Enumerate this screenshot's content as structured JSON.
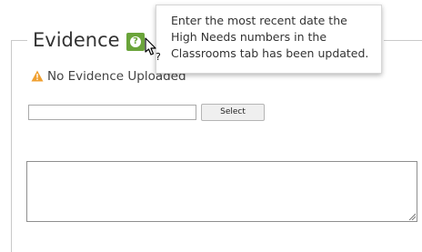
{
  "section": {
    "legend": "Evidence",
    "status_text": "No Evidence Uploaded",
    "help_icon": "question-icon",
    "warning_icon": "warning-icon"
  },
  "upload": {
    "file_value": "",
    "select_label": "Select"
  },
  "notes": {
    "value": ""
  },
  "tooltip": {
    "text": "Enter the most recent date the\nHigh Needs numbers in the\nClassrooms tab has been updated."
  },
  "colors": {
    "help_icon_bg": "#6aa43a",
    "warning": "#f0a030",
    "frame": "#c9c9c9"
  }
}
